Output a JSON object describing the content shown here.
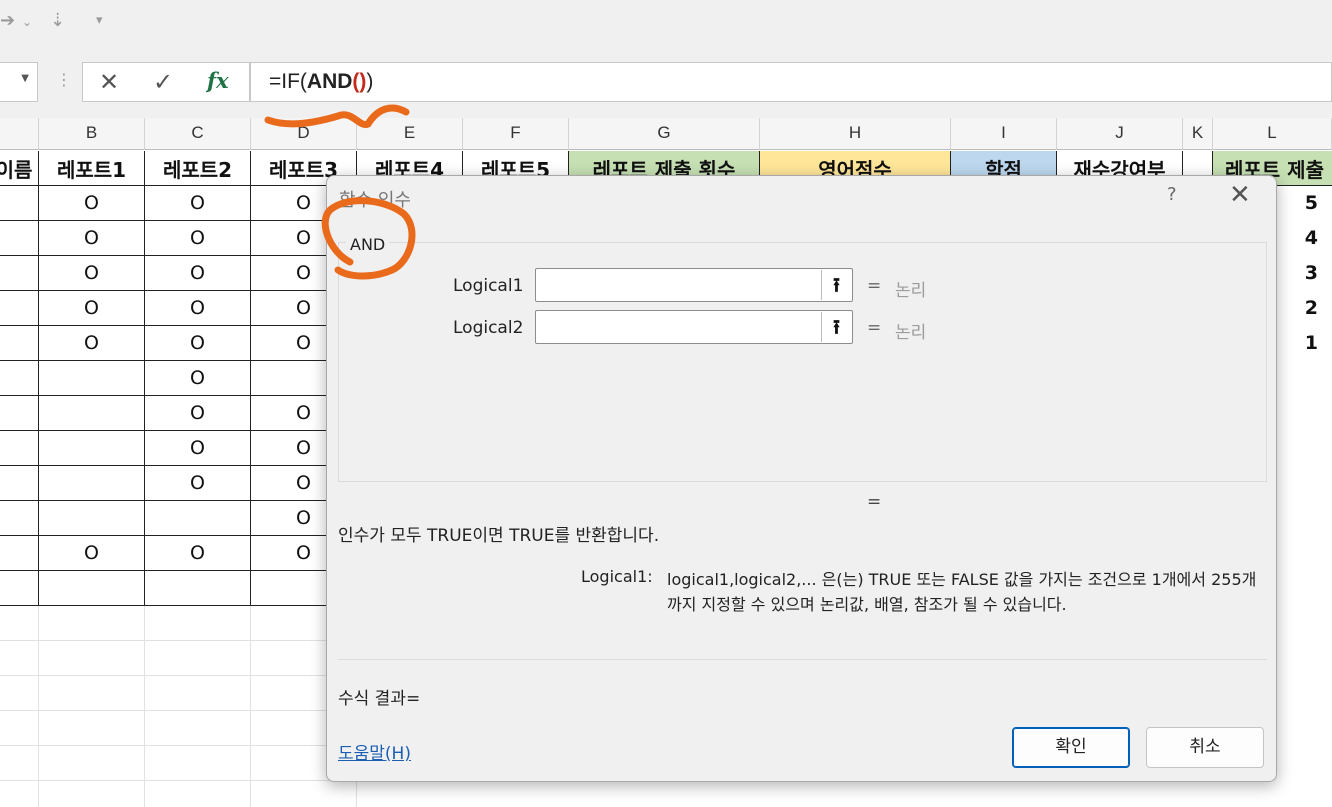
{
  "qat": {
    "redo_icon": "redo-arrow-icon",
    "sort_icon": "sort-icon",
    "customize_icon": "customize-qat-icon"
  },
  "formula_bar": {
    "cancel_icon": "x-icon",
    "enter_icon": "check-icon",
    "fx_label": "fx",
    "formula_prefix": "=IF(",
    "formula_func": "AND",
    "formula_parens": "()",
    "formula_suffix": ")"
  },
  "columns": [
    "B",
    "C",
    "D",
    "E",
    "F",
    "G",
    "H",
    "I",
    "J",
    "K",
    "L"
  ],
  "headers": [
    "이름",
    "레포트1",
    "레포트2",
    "레포트3",
    "레포트4",
    "레포트5",
    "레포트 제출 횟수",
    "영어점수",
    "학점",
    "재수강여부",
    "",
    "레포트 제출"
  ],
  "rows": [
    [
      "O",
      "O",
      "O"
    ],
    [
      "O",
      "O",
      "O"
    ],
    [
      "O",
      "O",
      "O"
    ],
    [
      "O",
      "O",
      "O"
    ],
    [
      "O",
      "O",
      "O"
    ],
    [
      "",
      "O",
      ""
    ],
    [
      "",
      "O",
      "O"
    ],
    [
      "",
      "O",
      "O"
    ],
    [
      "",
      "O",
      "O"
    ],
    [
      "",
      "",
      "O"
    ],
    [
      "O",
      "O",
      "O"
    ],
    [
      "",
      "",
      ""
    ]
  ],
  "column_l_values": [
    "5",
    "4",
    "3",
    "2",
    "1"
  ],
  "dialog": {
    "title": "함수 인수",
    "help_glyph": "?",
    "close_glyph": "✕",
    "function_name": "AND",
    "args": [
      {
        "label": "Logical1",
        "value": "",
        "eq": "=",
        "result": "논리"
      },
      {
        "label": "Logical2",
        "value": "",
        "eq": "=",
        "result": "논리"
      }
    ],
    "result_eq": "=",
    "description": "인수가 모두 TRUE이면 TRUE를 반환합니다.",
    "arg_desc_label": "Logical1:",
    "arg_desc_text": "logical1,logical2,... 은(는) TRUE 또는 FALSE 값을 가지는 조건으로 1개에서 255개까지 지정할 수 있으며 논리값, 배열, 참조가 될 수 있습니다.",
    "formula_result": "수식 결과=",
    "help_link": "도움말(H)",
    "ok_label": "확인",
    "cancel_label": "취소",
    "collapse_icon": "collapse-dialog-icon"
  },
  "colors": {
    "header_green": "#c6e0b4",
    "header_yellow": "#ffe699",
    "header_blue": "#bdd7ee",
    "annotation": "#ea6a1c"
  }
}
